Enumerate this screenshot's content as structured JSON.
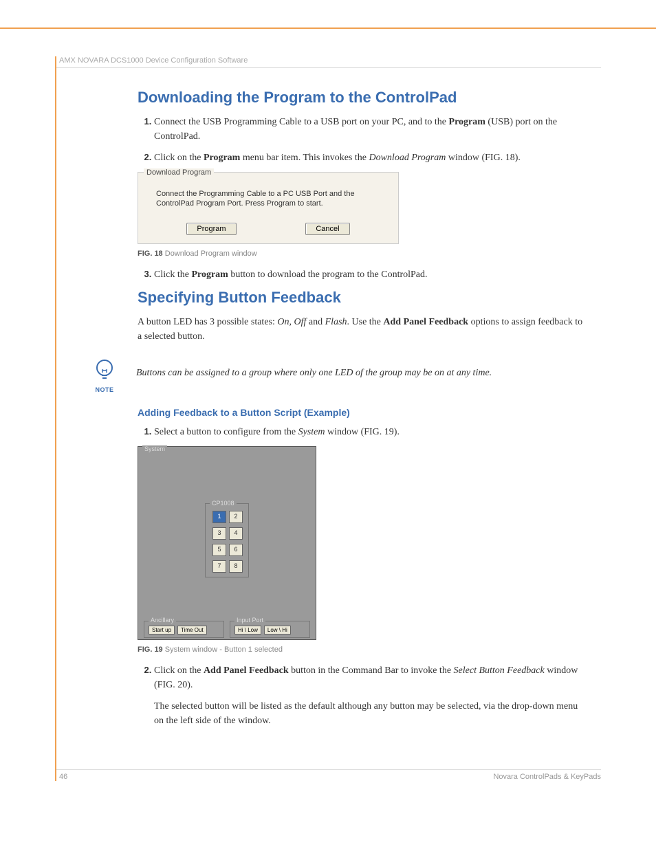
{
  "header": "AMX NOVARA DCS1000 Device Configuration Software",
  "section1": {
    "title": "Downloading the Program to the ControlPad",
    "steps": {
      "s1": {
        "pre": "Connect the USB Programming Cable to a USB port on your PC, and to the ",
        "b": "Program",
        "post": " (USB) port on the ControlPad."
      },
      "s2": {
        "pre": "Click on the ",
        "b": "Program",
        "mid": " menu bar item. This invokes the ",
        "i": "Download Program",
        "post": " window (FIG. 18)."
      },
      "s3": {
        "pre": "Click the ",
        "b": "Program",
        "post": " button to download the program to the ControlPad."
      }
    }
  },
  "fig18": {
    "groupTitle": "Download Program",
    "text": "Connect  the Programming Cable to a PC USB Port and the ControlPad Program Port.  Press Program to start.",
    "programBtn": "Program",
    "cancelBtn": "Cancel",
    "caption": {
      "num": "FIG. 18",
      "txt": "Download Program window"
    }
  },
  "section2": {
    "title": "Specifying Button Feedback",
    "intro": {
      "pre": "A button LED has 3 possible states: ",
      "i1": "On",
      "c1": ", ",
      "i2": "Off",
      "c2": " and ",
      "i3": "Flash",
      "mid": ". Use the ",
      "b": "Add Panel Feedback",
      "post": " options to assign feedback to a selected button."
    },
    "note": {
      "label": "NOTE",
      "text": "Buttons can be assigned to a group where only one LED of the group may be on at any time."
    },
    "sub": "Adding Feedback to a Button Script (Example)",
    "steps": {
      "s1": {
        "pre": "Select a button to configure from the ",
        "i": "System",
        "post": " window (FIG. 19)."
      },
      "s2": {
        "pre": "Click on the ",
        "b": "Add Panel Feedback",
        "mid": " button in the Command Bar to invoke the ",
        "i": "Select Button Feedback",
        "post": " window (FIG. 20)."
      }
    },
    "continued": "The selected button will be listed as the default although any button may be selected, via the drop-down menu on the left side of the window."
  },
  "fig19": {
    "sysTitle": "System",
    "cpTitle": "CP1008",
    "buttons": [
      "1",
      "2",
      "3",
      "4",
      "5",
      "6",
      "7",
      "8"
    ],
    "anc": {
      "title": "Ancillary",
      "b1": "Start up",
      "b2": "Time Out"
    },
    "inp": {
      "title": "Input Port",
      "b1": "Hi \\ Low",
      "b2": "Low \\ Hi"
    },
    "caption": {
      "num": "FIG. 19",
      "txt": "System window - Button 1 selected"
    }
  },
  "footer": {
    "page": "46",
    "title": "Novara ControlPads & KeyPads"
  }
}
